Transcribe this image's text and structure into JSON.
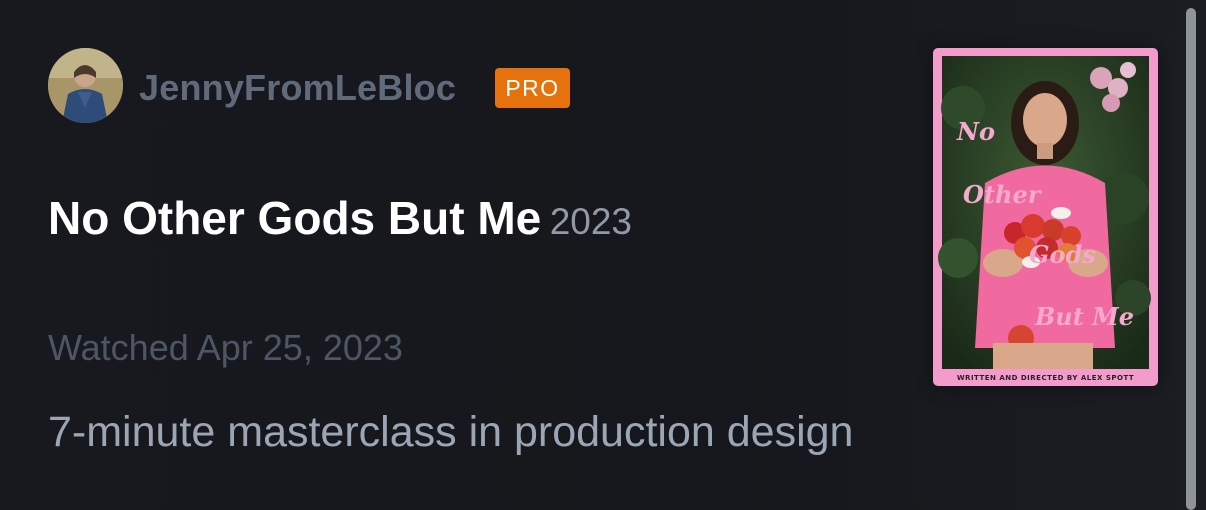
{
  "entry": {
    "user": {
      "username": "JennyFromLeBloc",
      "badge": "PRO",
      "avatar_icon": "user-avatar"
    },
    "film": {
      "title": "No Other Gods But Me",
      "year": "2023"
    },
    "watched": "Watched Apr 25, 2023",
    "review": "7-minute masterclass in production design",
    "poster": {
      "title_lines": [
        "No",
        "Other",
        "Gods",
        "But Me"
      ],
      "credit": "WRITTEN AND DIRECTED BY ALEX SPOTT"
    }
  },
  "colors": {
    "background": "#15171c",
    "badge": "#e6720e",
    "title": "#ffffff",
    "username": "#5f6b7b",
    "muted": "#4c5664",
    "review": "#9aa6b4",
    "poster_frame": "#f39ccc"
  }
}
